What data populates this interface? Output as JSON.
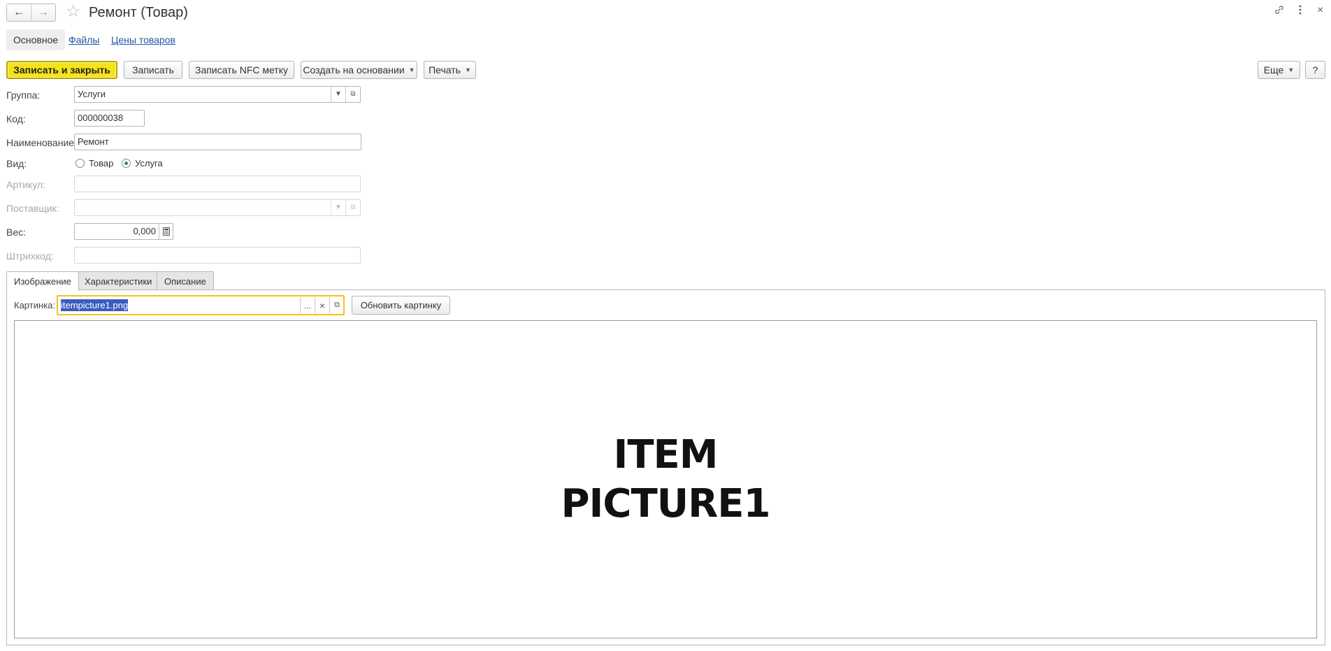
{
  "window": {
    "title": "Ремонт (Товар)",
    "icons": {
      "back": "arrow-left",
      "forward": "arrow-right",
      "favorite": "star",
      "link": "link",
      "more": "vertical-dots",
      "close": "close"
    }
  },
  "sections": [
    {
      "label": "Основное",
      "active": true
    },
    {
      "label": "Файлы",
      "active": false
    },
    {
      "label": "Цены товаров",
      "active": false
    }
  ],
  "toolbar": {
    "save_close": "Записать и закрыть",
    "save": "Записать",
    "save_nfc": "Записать NFC метку",
    "create_based": "Создать на основании",
    "print": "Печать",
    "more": "Еще",
    "help": "?"
  },
  "form": {
    "group_label": "Группа:",
    "group_value": "Услуги",
    "code_label": "Код:",
    "code_value": "000000038",
    "name_label": "Наименование:",
    "name_value": "Ремонт",
    "kind_label": "Вид:",
    "kind_option1": "Товар",
    "kind_option2": "Услуга",
    "kind_selected": "Услуга",
    "article_label": "Артикул:",
    "article_value": "",
    "supplier_label": "Поставщик:",
    "supplier_value": "",
    "weight_label": "Вес:",
    "weight_value": "0,000",
    "barcode_label": "Штрихкод:",
    "barcode_value": ""
  },
  "tabs": [
    {
      "label": "Изображение",
      "active": true
    },
    {
      "label": "Характеристики",
      "active": false
    },
    {
      "label": "Описание",
      "active": false
    }
  ],
  "image_tab": {
    "picture_label": "Картинка:",
    "picture_value": "itempicture1.png",
    "select_btn": "...",
    "clear_btn": "×",
    "refresh_label": "Обновить картинку",
    "picture_line1": "ITEM",
    "picture_line2": "PICTURE1"
  },
  "colors": {
    "primary_button": "#f5e21a",
    "focus_border": "#f0c419",
    "link": "#2255aa",
    "selection": "#3a5bc0"
  }
}
